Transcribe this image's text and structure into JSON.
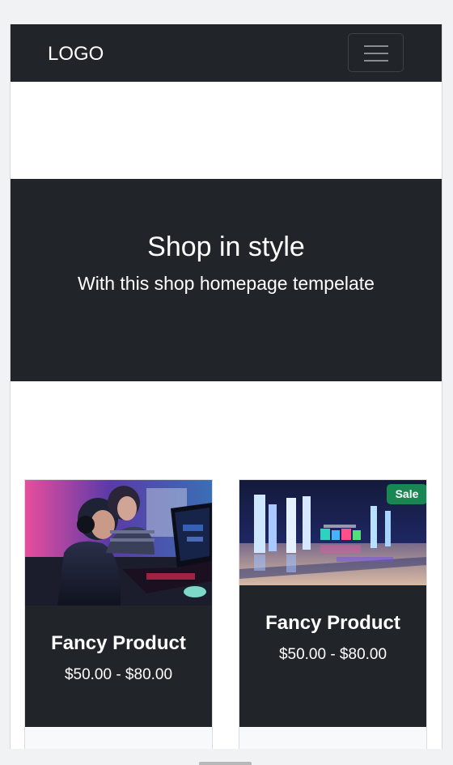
{
  "navbar": {
    "logo": "LOGO",
    "toggle_icon": "hamburger-icon"
  },
  "hero": {
    "title": "Shop in style",
    "subtitle": "With this shop homepage tempelate"
  },
  "products": [
    {
      "title": "Fancy Product",
      "price": "$50.00 - $80.00",
      "image": "gaming-laptop-photo"
    },
    {
      "title": "Fancy Product",
      "price": "$50.00 - $80.00",
      "badge": "Sale",
      "image": "event-hall-lights-photo"
    }
  ],
  "colors": {
    "dark": "#212529",
    "badge_green": "#198754",
    "white": "#ffffff"
  }
}
